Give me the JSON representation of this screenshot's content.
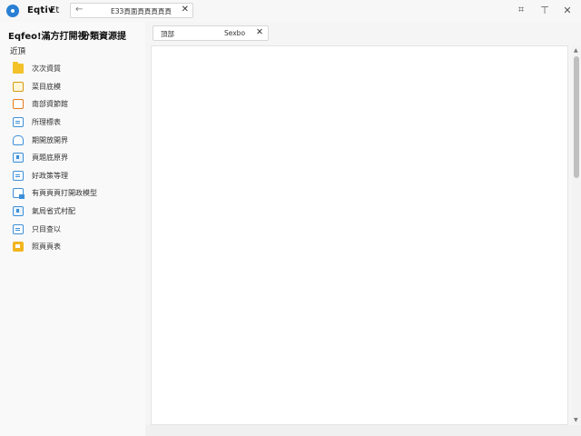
{
  "topbar": {
    "title": "Eqtiv",
    "menu": "Et",
    "url_icon": "search-icon",
    "url_text": "ЕЗЗ頁面頁頁頁頁頁",
    "url_close": "✕",
    "pin_symbol": "⌗",
    "minimize_symbol": "⊤",
    "close_symbol": "✕"
  },
  "sidebar": {
    "heading": "Eqfeo!滿方打開視",
    "heading2": "分類資源提",
    "section": "近頂",
    "items": [
      {
        "label": "次次資質",
        "icon": "folder-icon"
      },
      {
        "label": "菜目底模",
        "icon": "box-icon"
      },
      {
        "label": "南部資節館",
        "icon": "box-icon"
      },
      {
        "label": "所理標表",
        "icon": "document-icon"
      },
      {
        "label": "期開放開界",
        "icon": "bell-icon"
      },
      {
        "label": "頁題底原界",
        "icon": "document-icon"
      },
      {
        "label": "好政策等理",
        "icon": "document-icon"
      },
      {
        "label": "有頁頁頁打開政模型",
        "icon": "image-document-icon"
      },
      {
        "label": "氣局省式村配",
        "icon": "document-icon"
      },
      {
        "label": "只目查以",
        "icon": "document-icon"
      },
      {
        "label": "照頁頁表",
        "icon": "box-icon"
      }
    ]
  },
  "tab": {
    "label": "頂部",
    "search": "Sexbo",
    "close": "✕"
  },
  "scroll": {
    "up": "▲",
    "down": "▼"
  }
}
